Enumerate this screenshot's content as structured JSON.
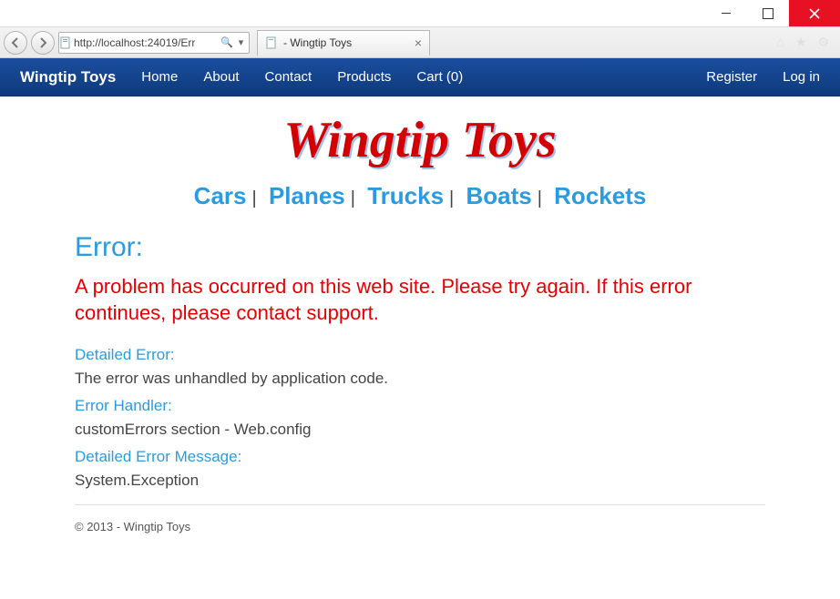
{
  "window": {
    "url": "http://localhost:24019/Err",
    "tab_title": " - Wingtip Toys"
  },
  "nav": {
    "brand": "Wingtip Toys",
    "links": [
      "Home",
      "About",
      "Contact",
      "Products",
      "Cart (0)"
    ],
    "right": [
      "Register",
      "Log in"
    ]
  },
  "logo_text": "Wingtip Toys",
  "categories": [
    "Cars",
    "Planes",
    "Trucks",
    "Boats",
    "Rockets"
  ],
  "error": {
    "title": "Error:",
    "message": "A problem has occurred on this web site. Please try again. If this error continues, please contact support.",
    "detailed_label": "Detailed Error:",
    "detailed_value": "The error was unhandled by application code.",
    "handler_label": "Error Handler:",
    "handler_value": "customErrors section - Web.config",
    "message_label": "Detailed Error Message:",
    "message_value": "System.Exception"
  },
  "footer": "© 2013 - Wingtip Toys"
}
